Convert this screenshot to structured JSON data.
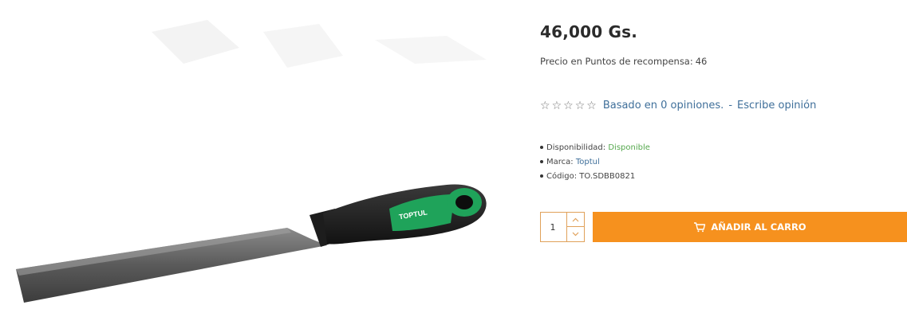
{
  "product": {
    "image_alt": "TOPTUL"
  },
  "price": {
    "text": "46,000 Gs."
  },
  "reward": {
    "label": "Precio en Puntos de recompensa:",
    "value": "46"
  },
  "rating": {
    "stars_filled": 0,
    "stars_total": 5,
    "based_on": "Basado en 0 opiniones.",
    "separator": "-",
    "write_review": "Escribe opinión"
  },
  "meta": {
    "availability_label": "Disponibilidad:",
    "availability_value": "Disponible",
    "brand_label": "Marca:",
    "brand_value": "Toptul",
    "code_label": "Código:",
    "code_value": "TO.SDBB0821"
  },
  "cart": {
    "quantity": "1",
    "add_label": "AÑADIR AL CARRO"
  },
  "colors": {
    "accent": "#f6911e",
    "link": "#3f6f9a",
    "available": "#55a84d"
  }
}
